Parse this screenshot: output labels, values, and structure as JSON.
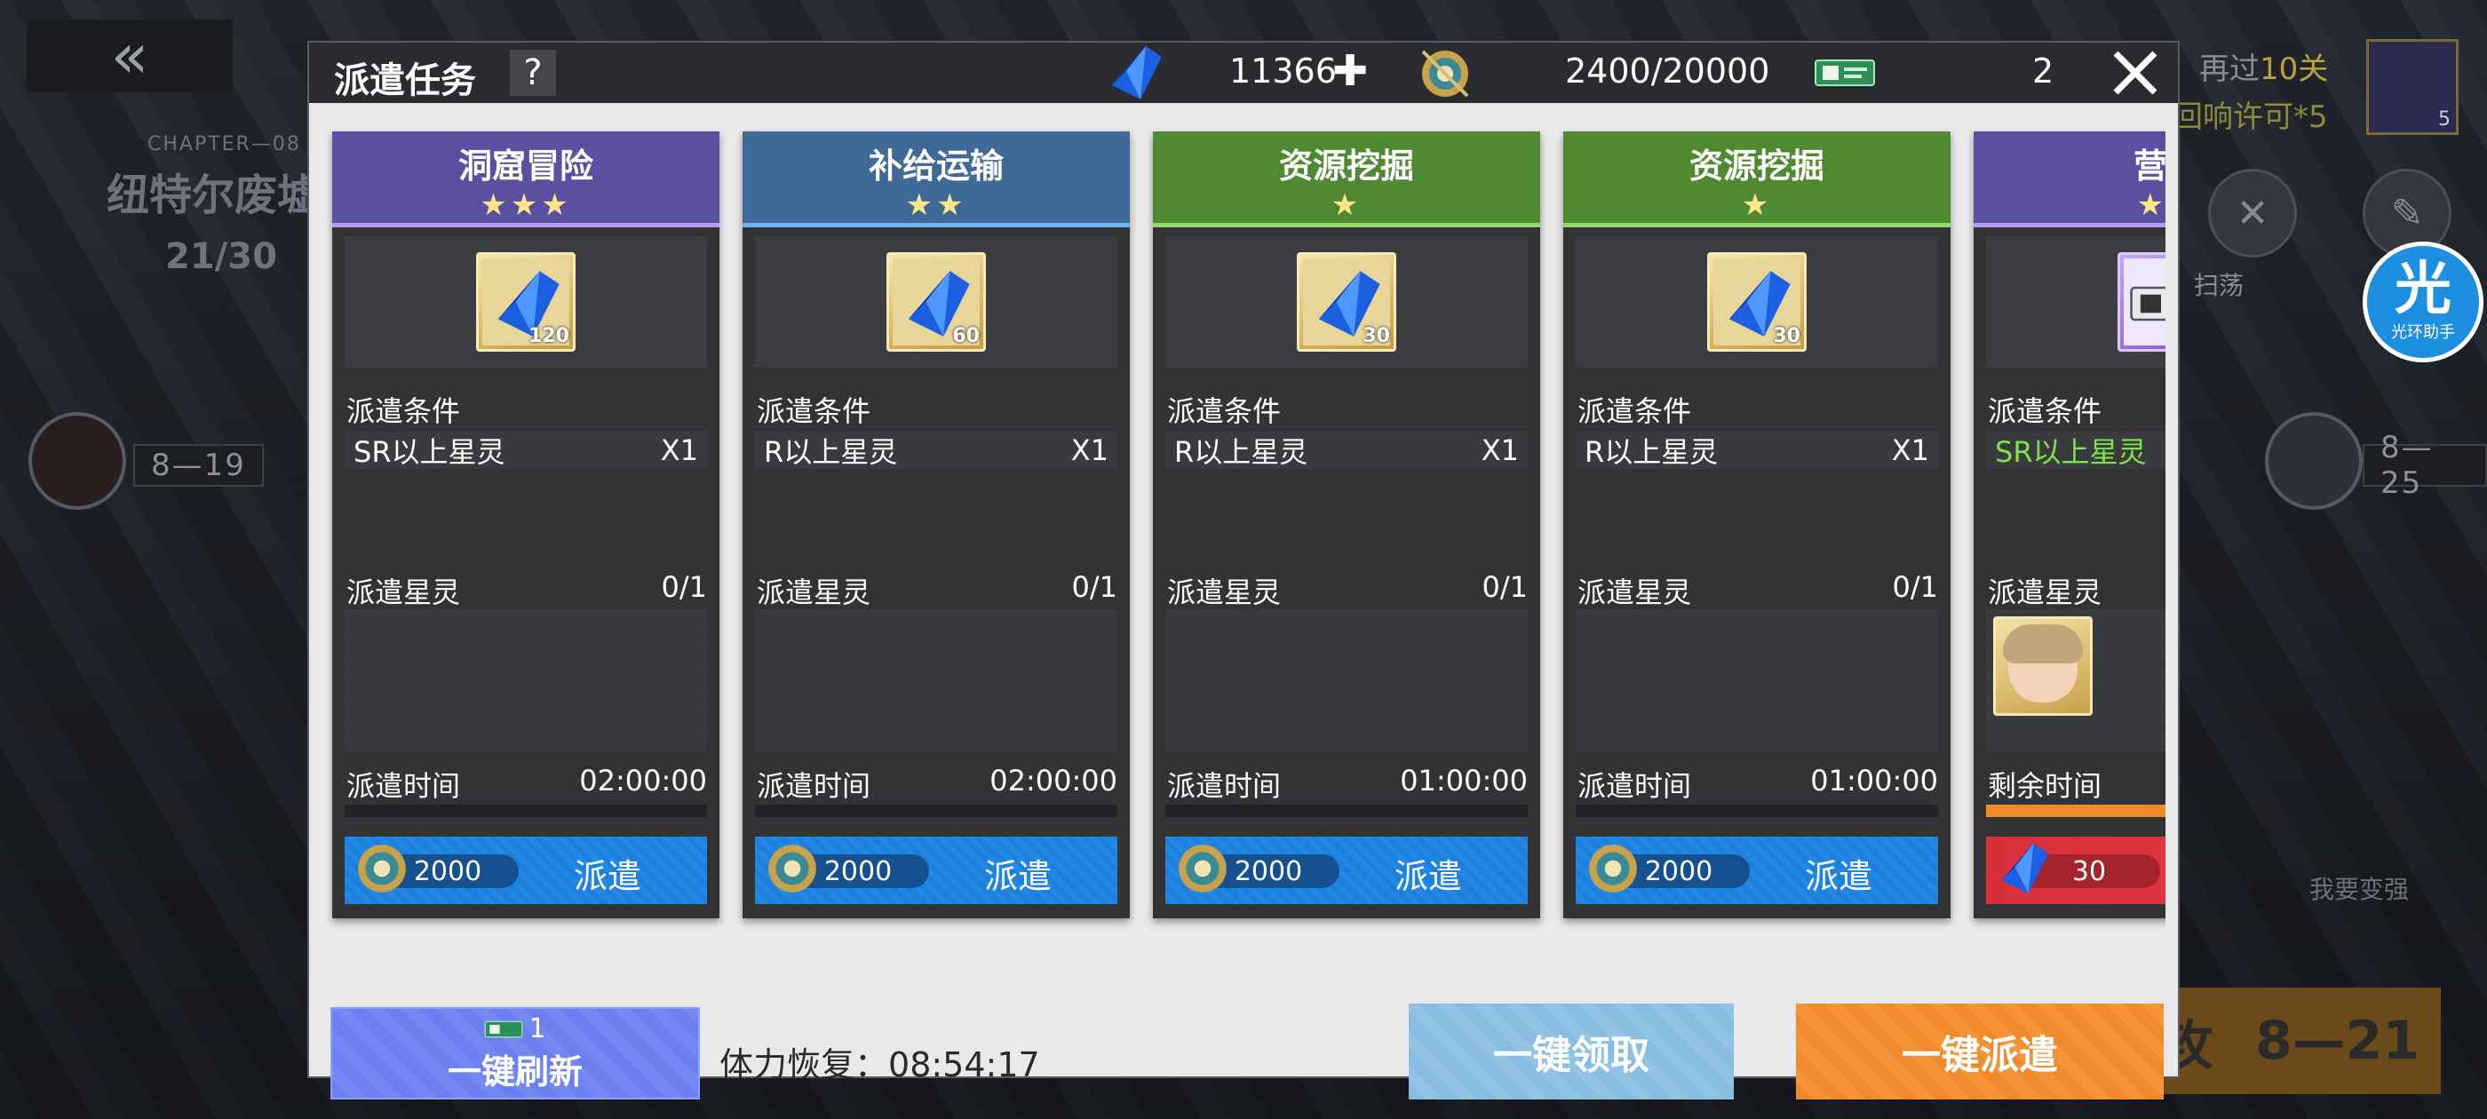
{
  "background": {
    "chapter": "CHAPTER—08",
    "stage_name": "纽特尔废墟",
    "progress": "21/30",
    "node_left": "8—19",
    "node_right": "8—25",
    "pass_prefix": "再过",
    "pass_count": "10关",
    "pass_reward": "回响许可*5",
    "item_qty": "5",
    "sweep_label": "扫荡",
    "attack_label": "进攻",
    "attack_stage": "8—21",
    "become_stronger": "我要变强",
    "helper_big": "光",
    "helper_small": "光环助手"
  },
  "dialog": {
    "title": "派遣任务",
    "help": "?",
    "gems": "11366",
    "gems_plus": "✚",
    "coins": "2400/20000",
    "tickets": "2"
  },
  "labels": {
    "condition": "派遣条件",
    "dispatch_member": "派遣星灵",
    "dispatch_time": "派遣时间",
    "remaining_time": "剩余时间",
    "dispatch": "派遣"
  },
  "cards": [
    {
      "name": "洞窟冒险",
      "stars": "★★★",
      "reward_qty": "120",
      "condition": "SR以上星灵",
      "condition_count": "X1",
      "members": "0/1",
      "time": "02:00:00",
      "cost": "2000"
    },
    {
      "name": "补给运输",
      "stars": "★★",
      "reward_qty": "60",
      "condition": "R以上星灵",
      "condition_count": "X1",
      "members": "0/1",
      "time": "02:00:00",
      "cost": "2000"
    },
    {
      "name": "资源挖掘",
      "stars": "★",
      "reward_qty": "30",
      "condition": "R以上星灵",
      "condition_count": "X1",
      "members": "0/1",
      "time": "01:00:00",
      "cost": "2000"
    },
    {
      "name": "资源挖掘",
      "stars": "★",
      "reward_qty": "30",
      "condition": "R以上星灵",
      "condition_count": "X1",
      "members": "0/1",
      "time": "01:00:00",
      "cost": "2000"
    },
    {
      "name": "营卫",
      "stars": "★★",
      "condition": "SR以上星灵",
      "cost": "30",
      "remaining_progress": 0.5
    }
  ],
  "footer": {
    "refresh_cost": "1",
    "refresh_label": "一键刷新",
    "stamina_label": "体力恢复：",
    "stamina_time": "08:54:17",
    "claim_all": "一键领取",
    "dispatch_all": "一键派遣"
  },
  "colors": {
    "accent_blue": "#1f7fdc",
    "accent_orange": "#f08a2c",
    "accent_red": "#d8303a",
    "condition_green": "#7ee24a"
  }
}
